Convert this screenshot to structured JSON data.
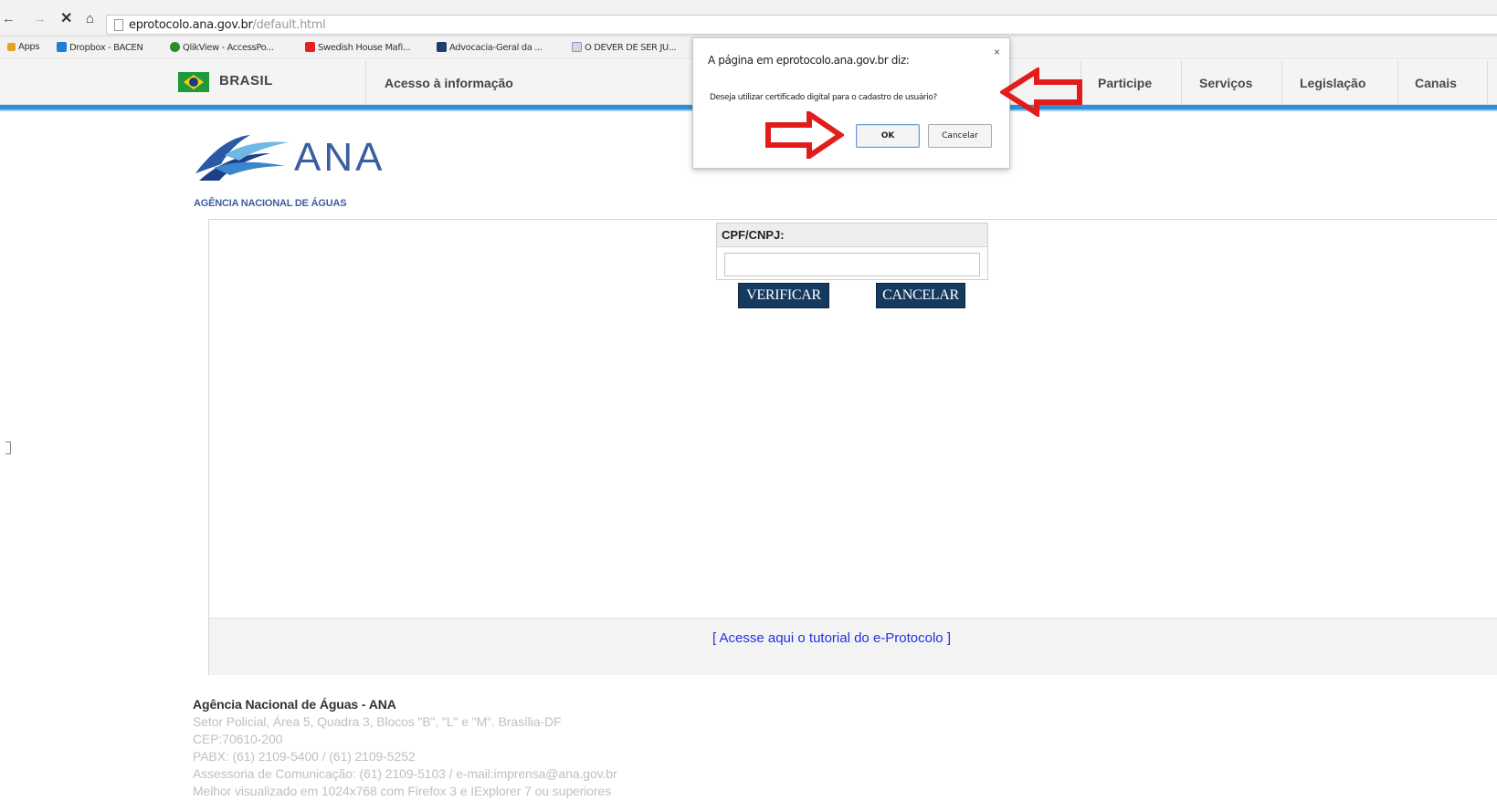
{
  "browser": {
    "url_host": "eprotocolo.ana.gov.br",
    "url_path": "/default.html",
    "bookmarks": [
      {
        "label": "Apps",
        "icon": "apps-icon"
      },
      {
        "label": "Dropbox - BACEN",
        "icon": "dropbox-icon"
      },
      {
        "label": "QlikView - AccessPo...",
        "icon": "qlikview-icon"
      },
      {
        "label": "Swedish House Mafi...",
        "icon": "youtube-icon"
      },
      {
        "label": "Advocacia-Geral da ...",
        "icon": "agu-icon"
      },
      {
        "label": "O DEVER DE SER JU...",
        "icon": "document-icon"
      }
    ]
  },
  "gov_bar": {
    "brand": "BRASIL",
    "access_info": "Acesso à informação",
    "links": [
      "Participe",
      "Serviços",
      "Legislação",
      "Canais"
    ]
  },
  "logo": {
    "name": "ANA",
    "subtitle": "AGÊNCIA NACIONAL DE ÁGUAS"
  },
  "form": {
    "cpf_label": "CPF/CNPJ:",
    "cpf_value": "",
    "verify_label": "VERIFICAR",
    "cancel_label": "CANCELAR",
    "tutorial_link": "[ Acesse aqui o tutorial do e-Protocolo ]"
  },
  "footer": {
    "org_name": "Agência Nacional de Águas - ANA",
    "lines": [
      "Setor Policial, Área 5, Quadra 3, Blocos \"B\", \"L\" e \"M\". Brasília-DF",
      "CEP:70610-200",
      "PABX: (61) 2109-5400 / (61) 2109-5252",
      "Assessoria de Comunicação: (61) 2109-5103 / e-mail:imprensa@ana.gov.br",
      "Melhor visualizado em 1024x768 com Firefox 3 e IExplorer 7 ou superiores"
    ]
  },
  "dialog": {
    "title": "A página em eprotocolo.ana.gov.br diz:",
    "message": "Deseja utilizar certificado digital para o cadastro de usuário?",
    "ok_label": "OK",
    "cancel_label": "Cancelar",
    "close_glyph": "×"
  },
  "colors": {
    "gov_blue": "#2f8fd6",
    "button_dark": "#153a5f",
    "ana_blue": "#3b5f9e",
    "annotation_red": "#e21b1b",
    "link_blue": "#2233dd"
  }
}
